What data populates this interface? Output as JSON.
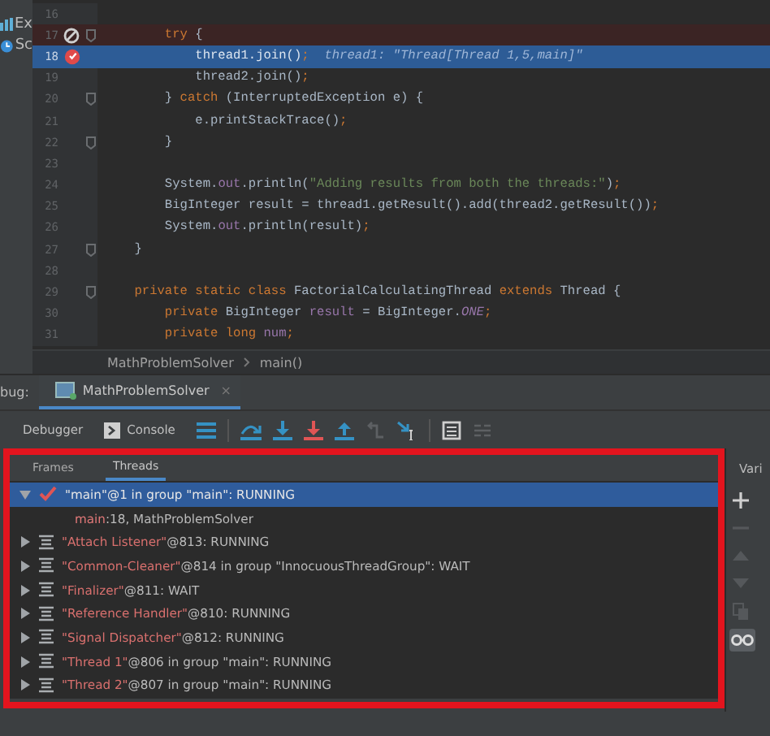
{
  "project_items": [
    {
      "label": "Ex",
      "kind": "chart"
    },
    {
      "label": "Sc",
      "kind": "schedule"
    }
  ],
  "editor": {
    "lines": [
      {
        "number": "16",
        "kind": "plain",
        "breakpoint": false,
        "fold": false
      },
      {
        "number": "17",
        "kind": "breakpoint",
        "breakpoint": true,
        "muted": true,
        "fold": true,
        "tokens": [
          {
            "kind": "kw",
            "text": "        try"
          },
          {
            "kind": "txt",
            "text": " {"
          }
        ]
      },
      {
        "number": "18",
        "kind": "current",
        "breakpoint": true,
        "muted": false,
        "fold": false,
        "tokens": [
          {
            "kind": "txt",
            "text": "            thread1.join()"
          },
          {
            "kind": "punct",
            "text": ";"
          },
          {
            "kind": "inline",
            "text": "  thread1: \"Thread[Thread 1,5,main]\""
          }
        ]
      },
      {
        "number": "19",
        "kind": "plain",
        "breakpoint": false,
        "fold": false,
        "tokens": [
          {
            "kind": "txt",
            "text": "            thread2.join()"
          },
          {
            "kind": "punct",
            "text": ";"
          }
        ]
      },
      {
        "number": "20",
        "kind": "plain",
        "breakpoint": false,
        "fold": true,
        "tokens": [
          {
            "kind": "txt",
            "text": "        } "
          },
          {
            "kind": "kw",
            "text": "catch"
          },
          {
            "kind": "txt",
            "text": " (InterruptedException e) {"
          }
        ]
      },
      {
        "number": "21",
        "kind": "plain",
        "breakpoint": false,
        "fold": false,
        "tokens": [
          {
            "kind": "txt",
            "text": "            e.printStackTrace()"
          },
          {
            "kind": "punct",
            "text": ";"
          }
        ]
      },
      {
        "number": "22",
        "kind": "plain",
        "breakpoint": false,
        "fold": true,
        "tokens": [
          {
            "kind": "txt",
            "text": "        }"
          }
        ]
      },
      {
        "number": "23",
        "kind": "plain",
        "breakpoint": false,
        "fold": false
      },
      {
        "number": "24",
        "kind": "plain",
        "breakpoint": false,
        "fold": false,
        "tokens": [
          {
            "kind": "txt",
            "text": "        System."
          },
          {
            "kind": "field",
            "text": "out"
          },
          {
            "kind": "txt",
            "text": ".println("
          },
          {
            "kind": "str",
            "text": "\"Adding results from both the threads:\""
          },
          {
            "kind": "txt",
            "text": ")"
          },
          {
            "kind": "punct",
            "text": ";"
          }
        ]
      },
      {
        "number": "25",
        "kind": "plain",
        "breakpoint": false,
        "fold": false,
        "tokens": [
          {
            "kind": "txt",
            "text": "        BigInteger result = thread1.getResult().add(thread2.getResult())"
          },
          {
            "kind": "punct",
            "text": ";"
          }
        ]
      },
      {
        "number": "26",
        "kind": "plain",
        "breakpoint": false,
        "fold": false,
        "tokens": [
          {
            "kind": "txt",
            "text": "        System."
          },
          {
            "kind": "field",
            "text": "out"
          },
          {
            "kind": "txt",
            "text": ".println(result)"
          },
          {
            "kind": "punct",
            "text": ";"
          }
        ]
      },
      {
        "number": "27",
        "kind": "plain",
        "breakpoint": false,
        "fold": true,
        "tokens": [
          {
            "kind": "txt",
            "text": "    }"
          }
        ]
      },
      {
        "number": "28",
        "kind": "plain",
        "breakpoint": false,
        "fold": false
      },
      {
        "number": "29",
        "kind": "plain",
        "breakpoint": false,
        "fold": true,
        "tokens": [
          {
            "kind": "kw",
            "text": "    private static class"
          },
          {
            "kind": "txt",
            "text": " FactorialCalculatingThread "
          },
          {
            "kind": "kw",
            "text": "extends"
          },
          {
            "kind": "txt",
            "text": " Thread {"
          }
        ]
      },
      {
        "number": "30",
        "kind": "plain",
        "breakpoint": false,
        "fold": false,
        "tokens": [
          {
            "kind": "kw",
            "text": "        private"
          },
          {
            "kind": "txt",
            "text": " BigInteger "
          },
          {
            "kind": "field",
            "text": "result"
          },
          {
            "kind": "txt",
            "text": " = BigInteger."
          },
          {
            "kind": "static",
            "text": "ONE"
          },
          {
            "kind": "punct",
            "text": ";"
          }
        ]
      },
      {
        "number": "31",
        "kind": "plain",
        "breakpoint": false,
        "fold": false,
        "tokens": [
          {
            "kind": "kw",
            "text": "        private long"
          },
          {
            "kind": "field",
            "text": " num"
          },
          {
            "kind": "punct",
            "text": ";"
          }
        ]
      }
    ],
    "breadcrumb": [
      "MathProblemSolver",
      "main()"
    ]
  },
  "debug": {
    "label": "bug:",
    "tab": {
      "title": "MathProblemSolver",
      "close": "×"
    },
    "toolbar": {
      "tabs": [
        {
          "label": "Debugger",
          "icon": false
        },
        {
          "label": "Console",
          "icon": true
        }
      ],
      "actions": [
        {
          "kind": "frames",
          "disabled": false
        },
        {
          "kind": "step-over",
          "disabled": false
        },
        {
          "kind": "step-into",
          "disabled": false
        },
        {
          "kind": "force-step-into",
          "disabled": false
        },
        {
          "kind": "step-out",
          "disabled": false
        },
        {
          "kind": "drop-frame",
          "disabled": true
        },
        {
          "kind": "run-to-cursor",
          "disabled": false
        },
        {
          "kind": "evaluate",
          "disabled": false
        },
        {
          "kind": "trace",
          "disabled": true
        }
      ]
    },
    "subtabs": [
      {
        "label": "Frames",
        "selected": false
      },
      {
        "label": "Threads",
        "selected": true
      }
    ],
    "threads": [
      {
        "kind": "current",
        "name": "\"main\"",
        "rest": "@1 in group \"main\": RUNNING",
        "expanded": true,
        "selected": true,
        "children": [
          {
            "method": "main",
            "location": ":18, MathProblemSolver"
          }
        ]
      },
      {
        "kind": "thread",
        "name": "\"Attach Listener\"",
        "rest": "@813: RUNNING",
        "expanded": false,
        "selected": false
      },
      {
        "kind": "thread",
        "name": "\"Common-Cleaner\"",
        "rest": "@814 in group \"InnocuousThreadGroup\": WAIT",
        "expanded": false,
        "selected": false
      },
      {
        "kind": "thread",
        "name": "\"Finalizer\"",
        "rest": "@811: WAIT",
        "expanded": false,
        "selected": false
      },
      {
        "kind": "thread",
        "name": "\"Reference Handler\"",
        "rest": "@810: RUNNING",
        "expanded": false,
        "selected": false
      },
      {
        "kind": "thread",
        "name": "\"Signal Dispatcher\"",
        "rest": "@812: RUNNING",
        "expanded": false,
        "selected": false
      },
      {
        "kind": "thread",
        "name": "\"Thread 1\"",
        "rest": "@806 in group \"main\": RUNNING",
        "expanded": false,
        "selected": false
      },
      {
        "kind": "thread",
        "name": "\"Thread 2\"",
        "rest": "@807 in group \"main\": RUNNING",
        "expanded": false,
        "selected": false
      }
    ],
    "variables_tab": "Vari",
    "side_tools": [
      {
        "kind": "add",
        "disabled": false,
        "selected": false
      },
      {
        "kind": "remove",
        "disabled": true,
        "selected": false
      },
      {
        "kind": "up",
        "disabled": true,
        "selected": false
      },
      {
        "kind": "down",
        "disabled": true,
        "selected": false
      },
      {
        "kind": "copy",
        "disabled": true,
        "selected": false
      },
      {
        "kind": "glasses",
        "disabled": false,
        "selected": true
      }
    ]
  }
}
